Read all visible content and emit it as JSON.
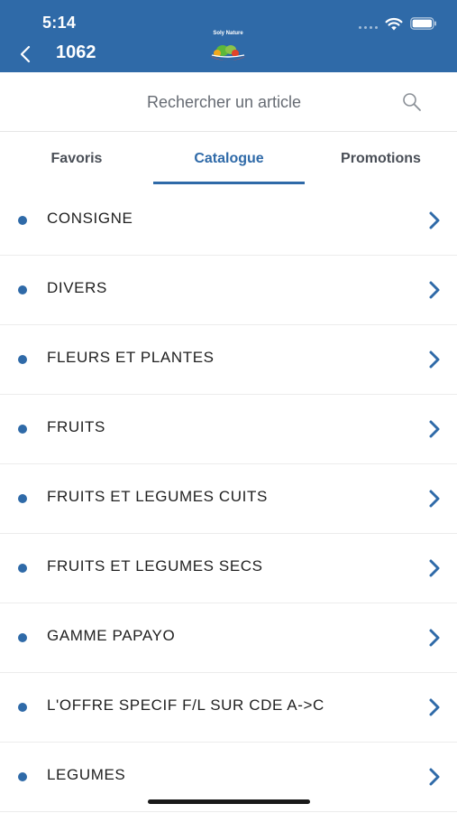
{
  "status_bar": {
    "time": "5:14"
  },
  "nav": {
    "title": "1062",
    "logo_text": "Soly Nature"
  },
  "search": {
    "placeholder": "Rechercher un article"
  },
  "tabs": [
    {
      "label": "Favoris",
      "active": false
    },
    {
      "label": "Catalogue",
      "active": true
    },
    {
      "label": "Promotions",
      "active": false
    }
  ],
  "categories": [
    {
      "label": "CONSIGNE"
    },
    {
      "label": "DIVERS"
    },
    {
      "label": "FLEURS ET PLANTES"
    },
    {
      "label": "FRUITS"
    },
    {
      "label": "FRUITS ET LEGUMES CUITS"
    },
    {
      "label": "FRUITS ET LEGUMES SECS"
    },
    {
      "label": "GAMME PAPAYO"
    },
    {
      "label": "L'OFFRE SPECIF F/L SUR CDE A->C"
    },
    {
      "label": "LEGUMES"
    }
  ],
  "colors": {
    "brand": "#2f6aa8",
    "text": "#1f1f1f"
  }
}
